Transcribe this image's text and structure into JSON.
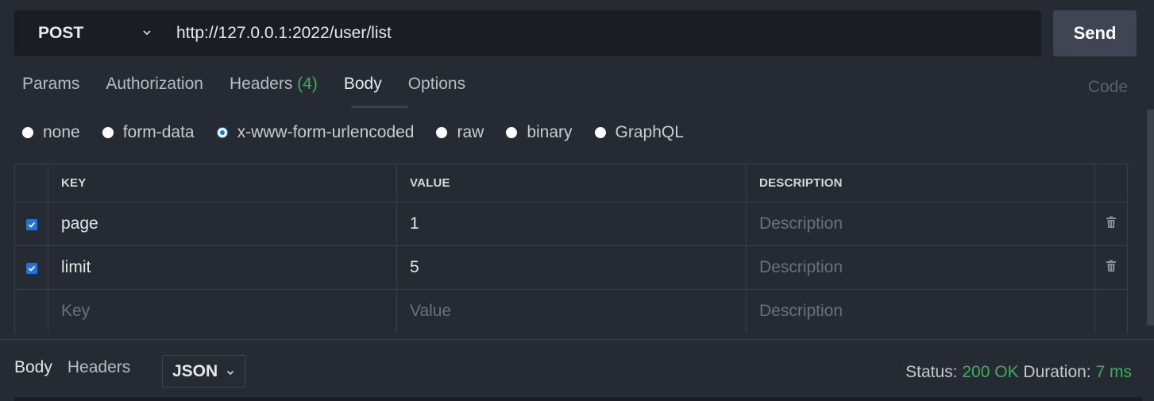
{
  "request": {
    "method": "POST",
    "url": "http://127.0.0.1:2022/user/list",
    "send_label": "Send"
  },
  "tabs": [
    {
      "label": "Params",
      "count": ""
    },
    {
      "label": "Authorization",
      "count": ""
    },
    {
      "label": "Headers",
      "count": "(4)"
    },
    {
      "label": "Body",
      "count": ""
    },
    {
      "label": "Options",
      "count": ""
    }
  ],
  "active_tab": "Body",
  "code_label": "Code",
  "body_types": [
    "none",
    "form-data",
    "x-www-form-urlencoded",
    "raw",
    "binary",
    "GraphQL"
  ],
  "selected_body_type": "x-www-form-urlencoded",
  "table": {
    "headers": {
      "key": "KEY",
      "value": "VALUE",
      "description": "DESCRIPTION"
    },
    "rows": [
      {
        "key": "page",
        "value": "1",
        "description_placeholder": "Description",
        "checked": true
      },
      {
        "key": "limit",
        "value": "5",
        "description_placeholder": "Description",
        "checked": true
      }
    ],
    "new_row": {
      "key_placeholder": "Key",
      "value_placeholder": "Value",
      "description_placeholder": "Description"
    }
  },
  "response": {
    "tabs": [
      "Body",
      "Headers"
    ],
    "format": "JSON",
    "status_label": "Status:",
    "status_value": "200 OK",
    "duration_label": "Duration:",
    "duration_value": "7 ms"
  },
  "colors": {
    "background": "#262a33",
    "url_bar": "#1b1d22",
    "accent_green": "#3fae5a",
    "checkbox_blue": "#1a73e8"
  }
}
